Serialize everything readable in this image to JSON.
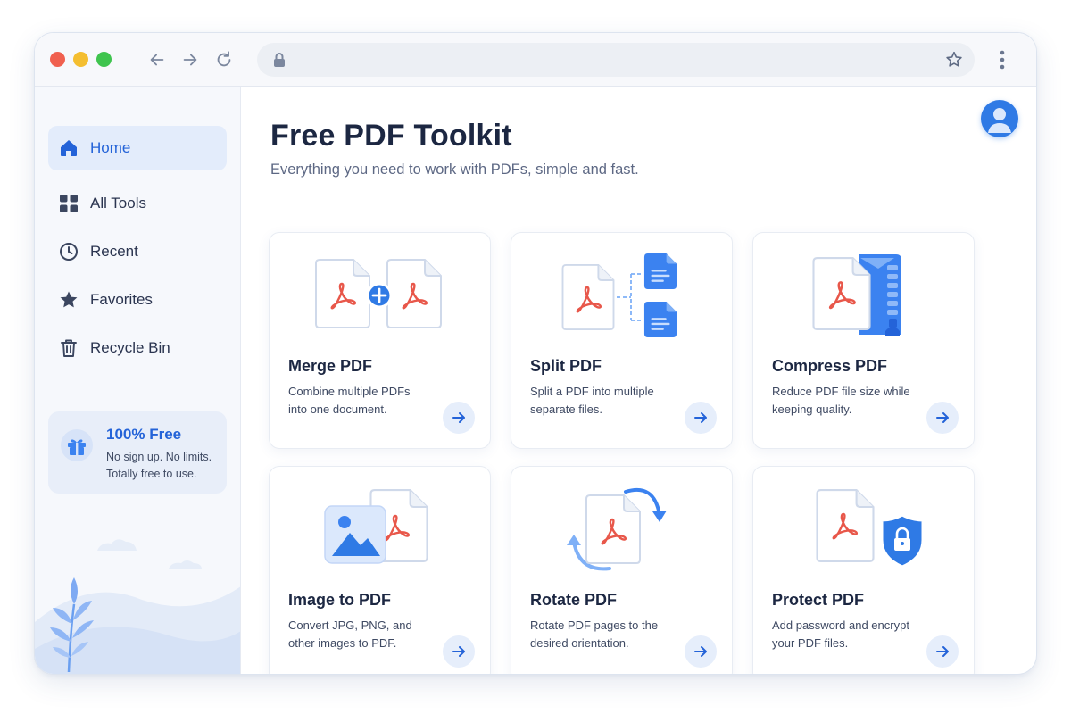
{
  "browser": {
    "url_value": "",
    "icons": [
      "back-arrow-icon",
      "forward-arrow-icon",
      "reload-icon",
      "lock-icon",
      "bookmark-star-icon",
      "more-vertical-icon"
    ]
  },
  "sidebar": {
    "items": [
      {
        "label": "Home",
        "icon": "home-icon",
        "active": true
      },
      {
        "label": "All Tools",
        "icon": "grid-icon",
        "active": false
      },
      {
        "label": "Recent",
        "icon": "clock-icon",
        "active": false
      },
      {
        "label": "Favorites",
        "icon": "star-icon",
        "active": false
      },
      {
        "label": "Recycle Bin",
        "icon": "trash-icon",
        "active": false
      }
    ],
    "promo": {
      "title": "100% Free",
      "text": "No sign up. No limits. Totally free to use.",
      "icon": "gift-icon"
    }
  },
  "main": {
    "title": "Free PDF Toolkit",
    "subtitle": "Everything you need to work with PDFs, simple and fast.",
    "tools": [
      {
        "title": "Merge PDF",
        "desc": "Combine multiple PDFs into one document.",
        "icon": "merge-pdf-icon"
      },
      {
        "title": "Split PDF",
        "desc": "Split a PDF into multiple separate files.",
        "icon": "split-pdf-icon"
      },
      {
        "title": "Compress PDF",
        "desc": "Reduce PDF file size while keeping quality.",
        "icon": "compress-pdf-icon"
      },
      {
        "title": "Image to PDF",
        "desc": "Convert JPG, PNG, and other images to PDF.",
        "icon": "image-to-pdf-icon"
      },
      {
        "title": "Rotate PDF",
        "desc": "Rotate PDF pages to the desired orientation.",
        "icon": "rotate-pdf-icon"
      },
      {
        "title": "Protect PDF",
        "desc": "Add password and encrypt your PDF files.",
        "icon": "protect-pdf-icon"
      }
    ]
  },
  "colors": {
    "accent": "#2463d8",
    "pdf_red": "#e8574a",
    "active_bg": "#e3ecfb",
    "traffic_red": "#f0604f",
    "traffic_yellow": "#f4be30",
    "traffic_green": "#3fc44e"
  }
}
